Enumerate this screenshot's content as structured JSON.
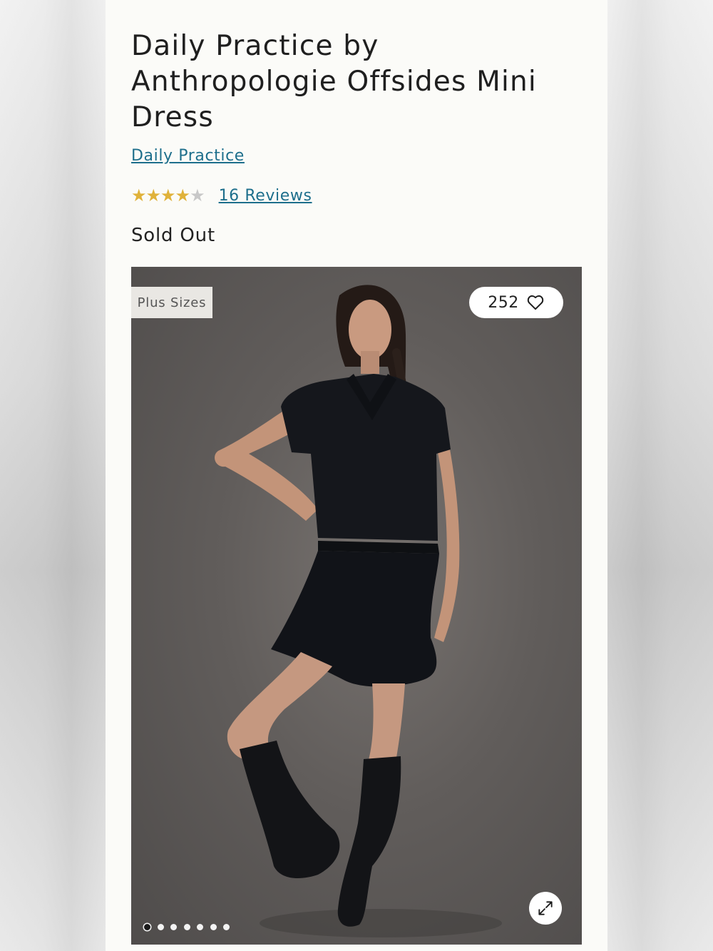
{
  "product": {
    "title": "Daily Practice by Anthropologie Offsides Mini Dress",
    "brand": "Daily Practice",
    "rating": 4,
    "rating_max": 5,
    "reviews_label": "16 Reviews",
    "availability": "Sold Out"
  },
  "gallery": {
    "badge": "Plus Sizes",
    "favorites_count": "252",
    "favorite_icon": "heart-icon",
    "expand_icon": "expand-arrows-icon",
    "image_count": 7,
    "active_index": 0
  },
  "colors": {
    "link": "#1e6f8c",
    "star": "#e0b23a",
    "star_empty": "#c8c8c8",
    "dress": "#15171c",
    "backdrop": "#615d5b"
  }
}
